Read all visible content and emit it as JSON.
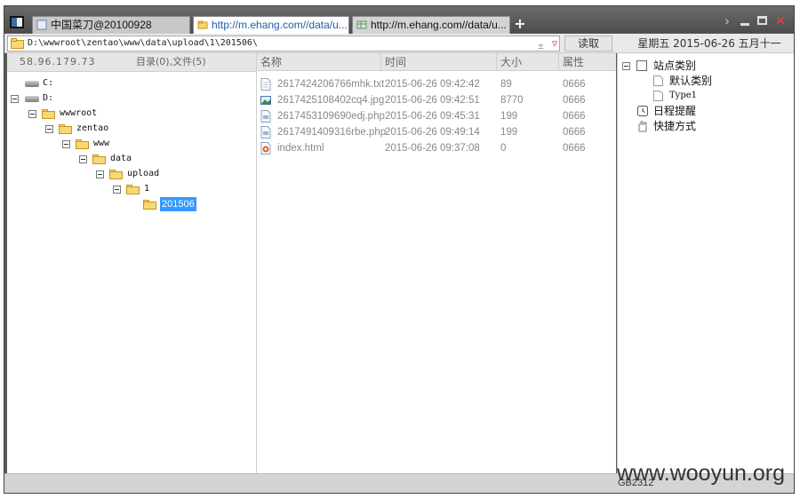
{
  "tabs": [
    {
      "label": "中国菜刀@20100928",
      "active": false
    },
    {
      "label": "http://m.ehang.com//data/u...",
      "active": true
    },
    {
      "label": "http://m.ehang.com//data/u...",
      "active": false
    }
  ],
  "tab_add_label": "+",
  "address": {
    "path": "D:\\wwwroot\\zentao\\www\\data\\upload\\1\\201506\\",
    "pm_label": "±",
    "read_label": "读取",
    "datetime": "星期五 2015-06-26 五月十一"
  },
  "left": {
    "ip": "58.96.179.73",
    "stats": "目录(0),文件(5)",
    "tree": [
      {
        "label": "C:",
        "type": "drive"
      },
      {
        "label": "D:",
        "type": "drive"
      },
      {
        "label": "wwwroot",
        "type": "folder"
      },
      {
        "label": "zentao",
        "type": "folder"
      },
      {
        "label": "www",
        "type": "folder"
      },
      {
        "label": "data",
        "type": "folder"
      },
      {
        "label": "upload",
        "type": "folder"
      },
      {
        "label": "1",
        "type": "folder"
      },
      {
        "label": "201506",
        "type": "folder-open",
        "selected": true
      }
    ]
  },
  "files": {
    "columns": [
      "名称",
      "时间",
      "大小",
      "属性"
    ],
    "rows": [
      {
        "name": "2617424206766mhk.txt",
        "time": "2015-06-26 09:42:42",
        "size": "89",
        "attr": "0666",
        "icon": "txt-file-icon"
      },
      {
        "name": "2617425108402cq4.jpg",
        "time": "2015-06-26 09:42:51",
        "size": "8770",
        "attr": "0666",
        "icon": "image-file-icon"
      },
      {
        "name": "2617453109690edj.php",
        "time": "2015-06-26 09:45:31",
        "size": "199",
        "attr": "0666",
        "icon": "php-file-icon"
      },
      {
        "name": "2617491409316rbe.php",
        "time": "2015-06-26 09:49:14",
        "size": "199",
        "attr": "0666",
        "icon": "php-file-icon"
      },
      {
        "name": "index.html",
        "time": "2015-06-26 09:37:08",
        "size": "0",
        "attr": "0666",
        "icon": "html-file-icon"
      }
    ]
  },
  "right": {
    "site_category": "站点类别",
    "default_category": "默认类别",
    "type1": "Type1",
    "schedule": "日程提醒",
    "shortcut": "快捷方式"
  },
  "status": {
    "encoding": "GB2312"
  },
  "watermark": "www.wooyun.org",
  "colors": {
    "selection": "#3399ff",
    "link_tab": "#1e5fa8",
    "close": "#ff3b3b"
  }
}
